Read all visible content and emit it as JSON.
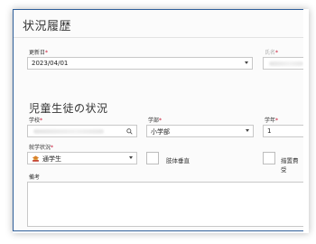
{
  "window": {
    "title": "状況履歴"
  },
  "update": {
    "label": "更新日",
    "required_mark": "*",
    "value": "2023/04/01"
  },
  "name": {
    "label": "氏名",
    "required_mark": "*"
  },
  "student": {
    "section_title": "児童生徒の状況",
    "school": {
      "label": "学校",
      "required_mark": "*"
    },
    "department": {
      "label": "学部",
      "required_mark": "*",
      "value": "小学部"
    },
    "grade": {
      "label": "学年",
      "required_mark": "*",
      "value": "1"
    },
    "attendance": {
      "label": "就学状況",
      "required_mark": "*",
      "value": "通学生"
    },
    "checkbox1": {
      "label": "肢体垂直"
    },
    "checkbox2": {
      "label": "措置費受"
    },
    "notes": {
      "label": "備考"
    }
  },
  "colors": {
    "window_border": "#2f5f9a",
    "required": "#c8102e"
  },
  "icons": {
    "search": "search-icon",
    "dropdown": "chevron-down-icon",
    "status": "student-status-icon"
  }
}
